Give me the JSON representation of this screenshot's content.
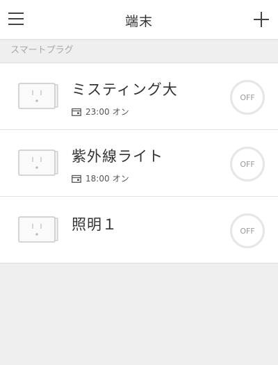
{
  "header": {
    "title": "端末"
  },
  "section": {
    "label": "スマートプラグ"
  },
  "devices": [
    {
      "name": "ミスティング大",
      "schedule_time": "23:00",
      "schedule_action": "オン",
      "state": "OFF"
    },
    {
      "name": "紫外線ライト",
      "schedule_time": "18:00",
      "schedule_action": "オン",
      "state": "OFF"
    },
    {
      "name": "照明１",
      "state": "OFF"
    }
  ],
  "icons": {
    "menu": "hamburger-menu-icon",
    "add": "plus-icon",
    "device": "smart-plug-icon",
    "schedule": "calendar-icon"
  },
  "colors": {
    "background": "#efefef",
    "card": "#ffffff",
    "label": "#a8a8a8",
    "toggle_ring": "#e6e6e6"
  }
}
